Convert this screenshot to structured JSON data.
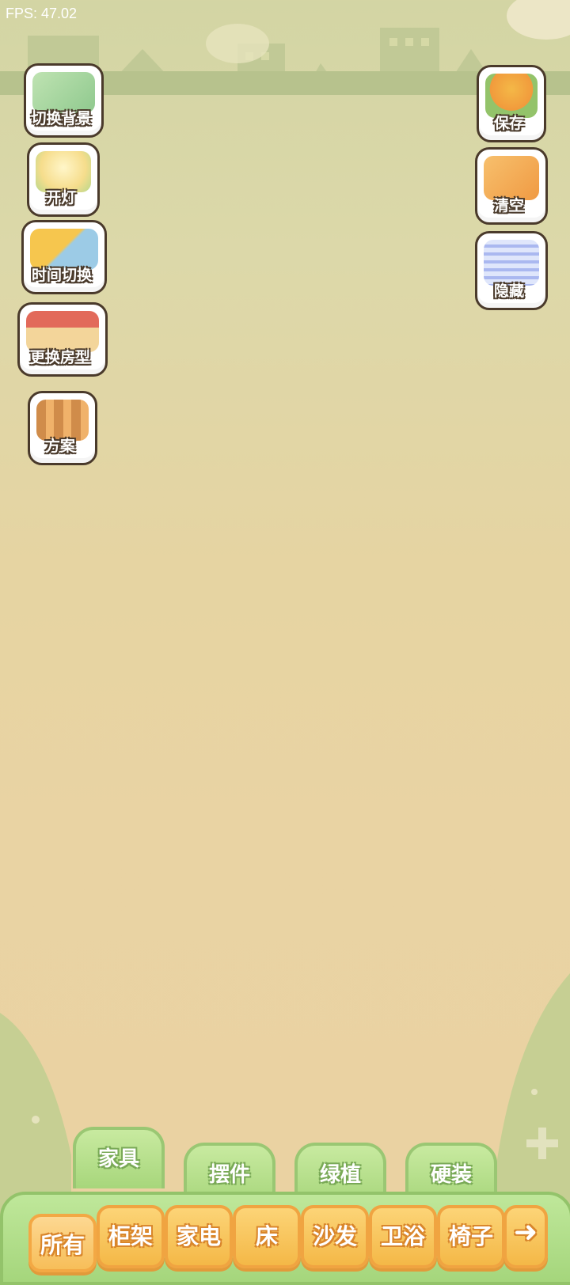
{
  "fps": "FPS: 47.02",
  "left_tools": [
    {
      "label": "切换背景",
      "icon": "switch-background-icon"
    },
    {
      "label": "开灯",
      "icon": "lamp-icon"
    },
    {
      "label": "时间切换",
      "icon": "sun-moon-icon"
    },
    {
      "label": "更换房型",
      "icon": "house-icon"
    },
    {
      "label": "方案",
      "icon": "plan-boxes-icon"
    }
  ],
  "right_tools": [
    {
      "label": "保存",
      "icon": "bird-save-icon"
    },
    {
      "label": "清空",
      "icon": "broom-clear-icon"
    },
    {
      "label": "隐藏",
      "icon": "hide-frame-icon"
    }
  ],
  "tabs": [
    "家具",
    "摆件",
    "绿植",
    "硬装"
  ],
  "active_tab": "家具",
  "categories": [
    "所有",
    "柜架",
    "家电",
    "床",
    "沙发",
    "卫浴",
    "椅子"
  ],
  "selected_category": "所有",
  "next_icon": "arrow-right-icon",
  "colors": {
    "accent_orange": "#f4b847",
    "accent_green": "#a7d67b",
    "outline": "#4a3a2b"
  }
}
